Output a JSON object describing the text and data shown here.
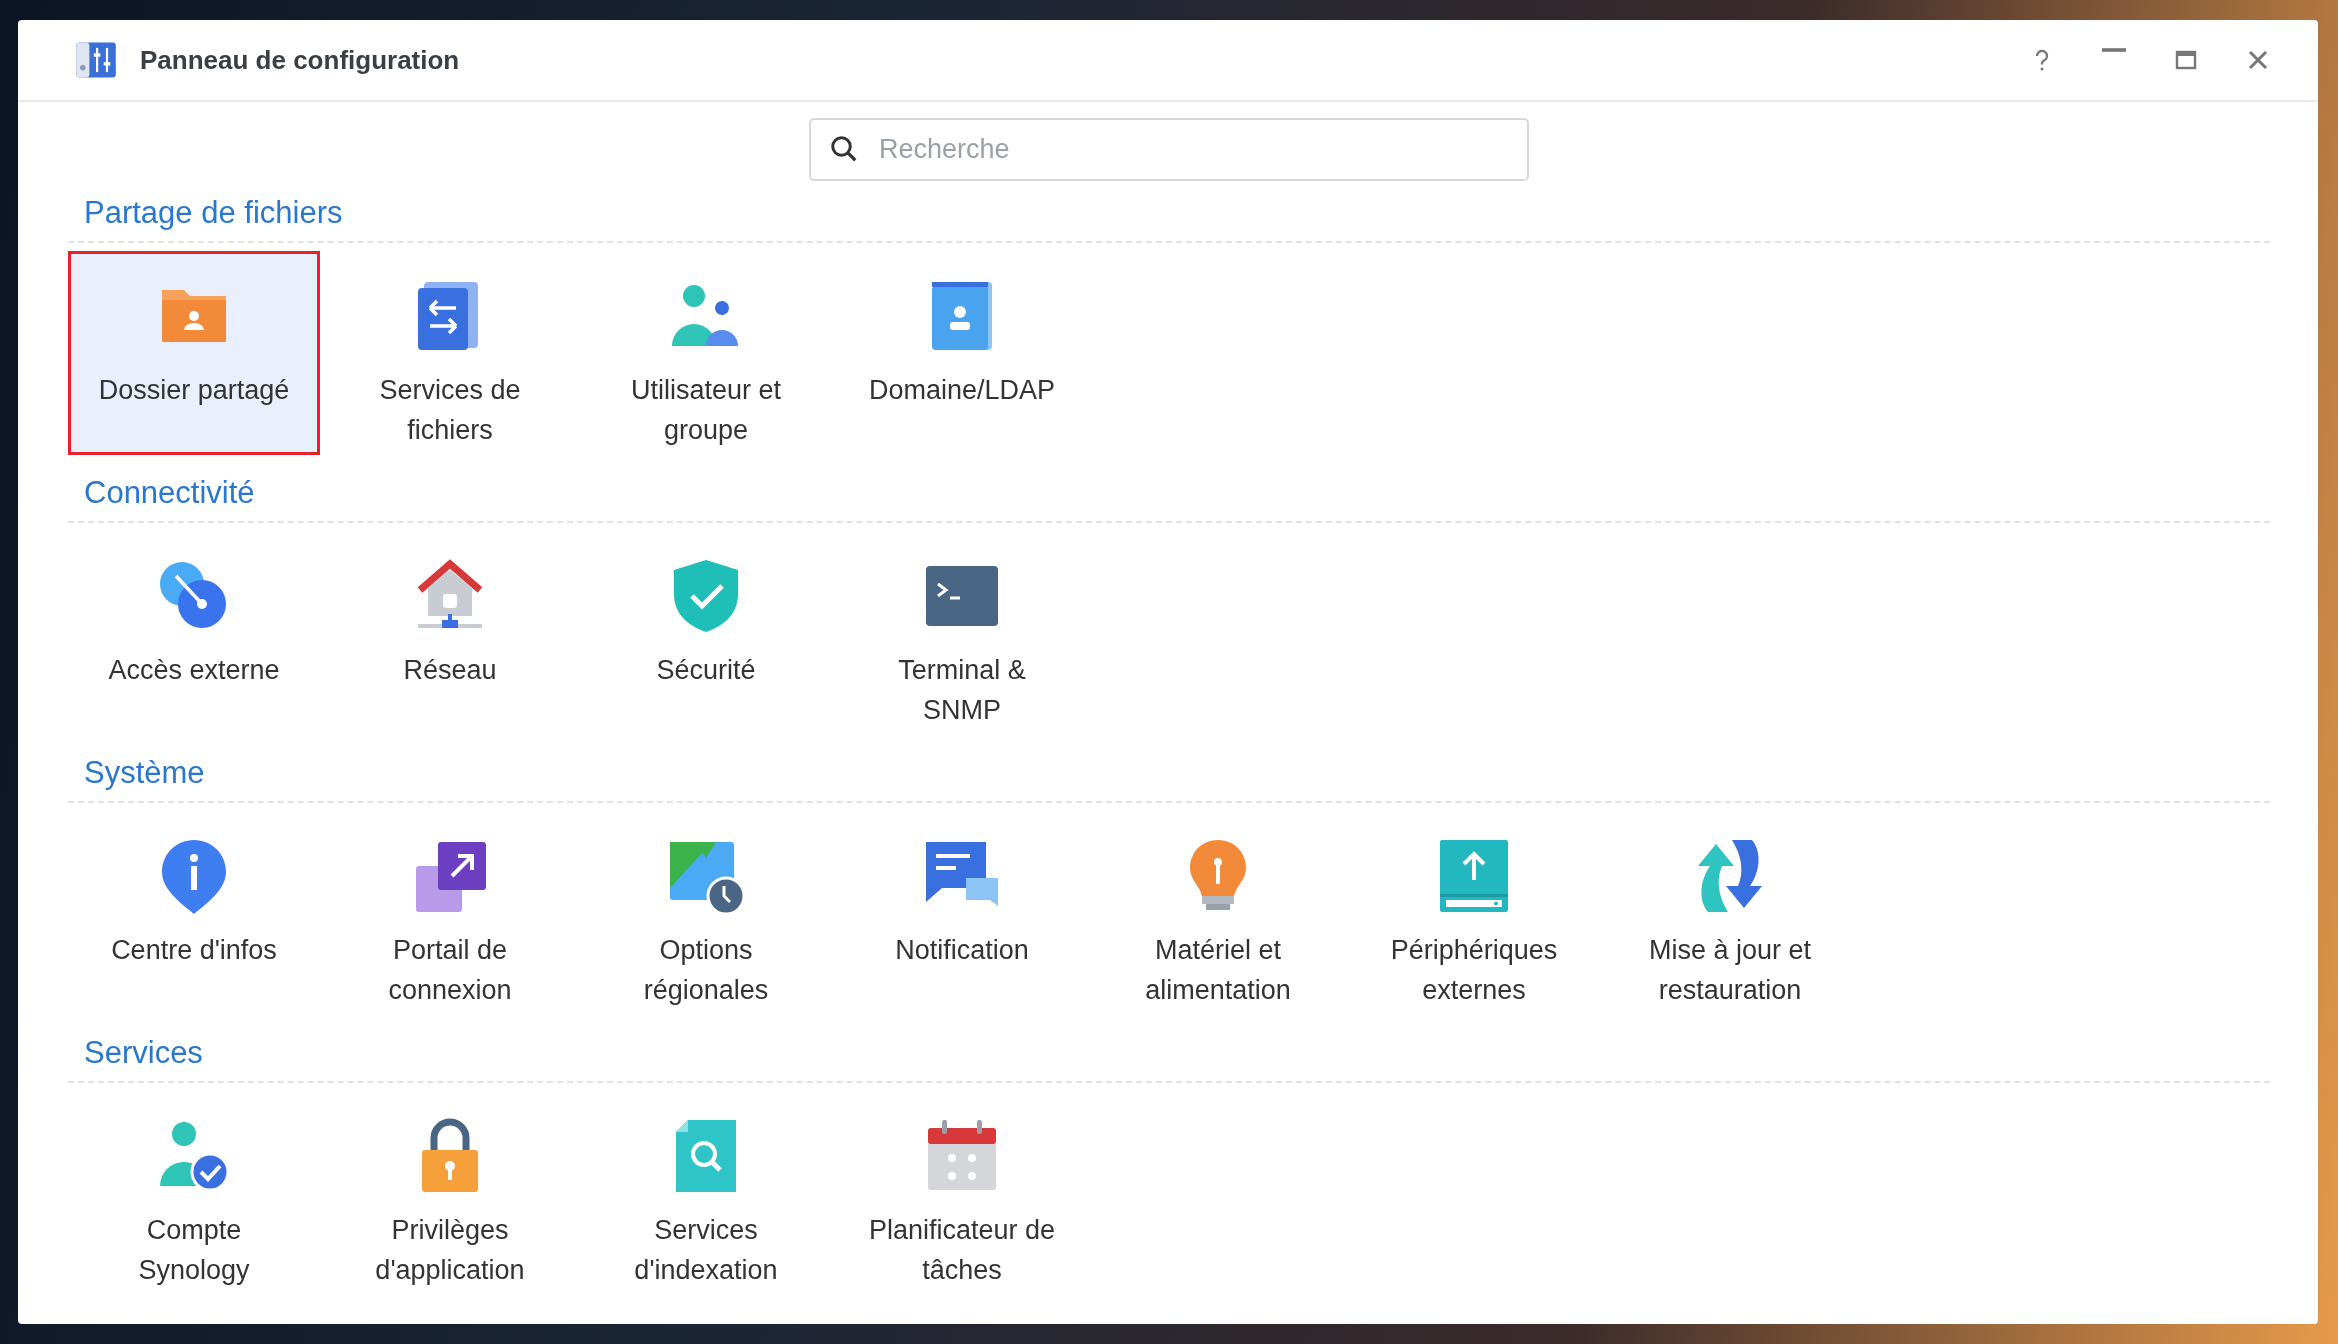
{
  "window": {
    "title": "Panneau de configuration"
  },
  "search": {
    "placeholder": "Recherche"
  },
  "sections": [
    {
      "title": "Partage de fichiers",
      "items": [
        {
          "label": "Dossier partagé",
          "kind": "folder",
          "selected": true
        },
        {
          "label": "Services de fichiers",
          "kind": "fileservices",
          "selected": false
        },
        {
          "label": "Utilisateur et groupe",
          "kind": "users",
          "selected": false
        },
        {
          "label": "Domaine/LDAP",
          "kind": "domain",
          "selected": false
        }
      ]
    },
    {
      "title": "Connectivité",
      "items": [
        {
          "label": "Accès externe",
          "kind": "externalaccess",
          "selected": false
        },
        {
          "label": "Réseau",
          "kind": "network",
          "selected": false
        },
        {
          "label": "Sécurité",
          "kind": "security",
          "selected": false
        },
        {
          "label": "Terminal & SNMP",
          "kind": "terminal",
          "selected": false
        }
      ]
    },
    {
      "title": "Système",
      "items": [
        {
          "label": "Centre d'infos",
          "kind": "info",
          "selected": false
        },
        {
          "label": "Portail de connexion",
          "kind": "portal",
          "selected": false
        },
        {
          "label": "Options régionales",
          "kind": "regional",
          "selected": false
        },
        {
          "label": "Notification",
          "kind": "notification",
          "selected": false
        },
        {
          "label": "Matériel et alimentation",
          "kind": "hardware",
          "selected": false
        },
        {
          "label": "Périphériques externes",
          "kind": "external",
          "selected": false
        },
        {
          "label": "Mise à jour et restauration",
          "kind": "update",
          "selected": false
        }
      ]
    },
    {
      "title": "Services",
      "items": [
        {
          "label": "Compte Synology",
          "kind": "account",
          "selected": false
        },
        {
          "label": "Privilèges d'application",
          "kind": "privileges",
          "selected": false
        },
        {
          "label": "Services d'indexation",
          "kind": "indexing",
          "selected": false
        },
        {
          "label": "Planificateur de tâches",
          "kind": "scheduler",
          "selected": false
        }
      ]
    }
  ]
}
